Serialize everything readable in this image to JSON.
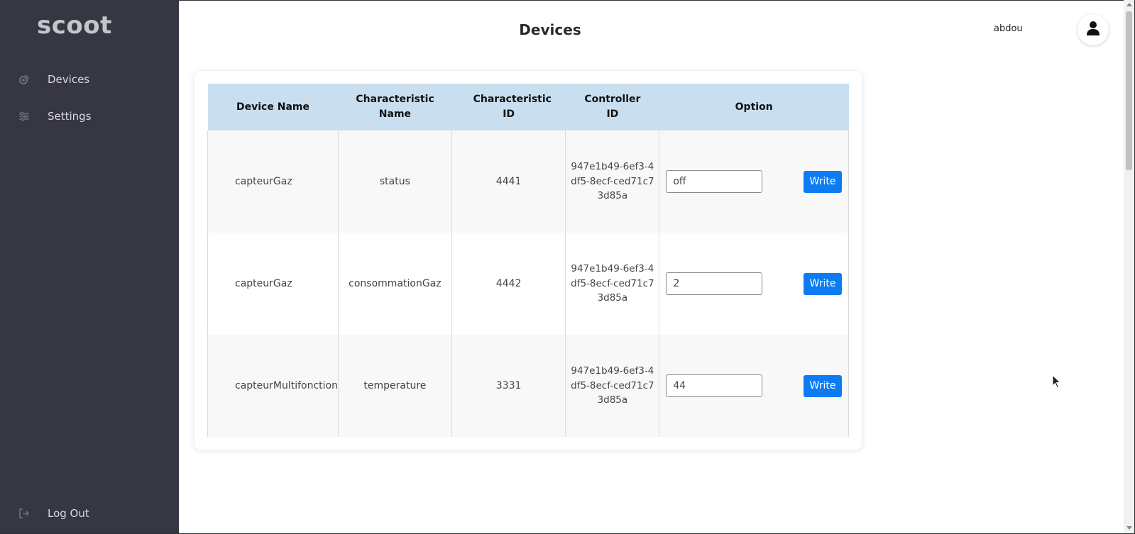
{
  "app": {
    "logo": "scoot"
  },
  "sidebar": {
    "items": [
      {
        "label": "Devices",
        "icon": "devices-icon"
      },
      {
        "label": "Settings",
        "icon": "sliders-icon"
      }
    ],
    "logout": {
      "label": "Log Out",
      "icon": "logout-icon"
    }
  },
  "header": {
    "title": "Devices",
    "username": "abdou",
    "avatar_icon": "user-icon"
  },
  "table": {
    "columns": [
      "Device Name",
      "Characteristic Name",
      "Characteristic ID",
      "Controller ID",
      "Option"
    ],
    "rows": [
      {
        "device": "capteurGaz",
        "characteristic": "status",
        "char_id": "4441",
        "controller_id": "947e1b49-6ef3-4df5-8ecf-ced71c73d85a",
        "value": "off",
        "button": "Write"
      },
      {
        "device": "capteurGaz",
        "characteristic": "consommationGaz",
        "char_id": "4442",
        "controller_id": "947e1b49-6ef3-4df5-8ecf-ced71c73d85a",
        "value": "2",
        "button": "Write"
      },
      {
        "device": "capteurMultifonction",
        "characteristic": "temperature",
        "char_id": "3331",
        "controller_id": "947e1b49-6ef3-4df5-8ecf-ced71c73d85a",
        "value": "44",
        "button": "Write"
      }
    ]
  },
  "colors": {
    "sidebar_bg": "#363742",
    "header_row_bg": "#c9dff0",
    "button_bg": "#0d7cf2"
  }
}
